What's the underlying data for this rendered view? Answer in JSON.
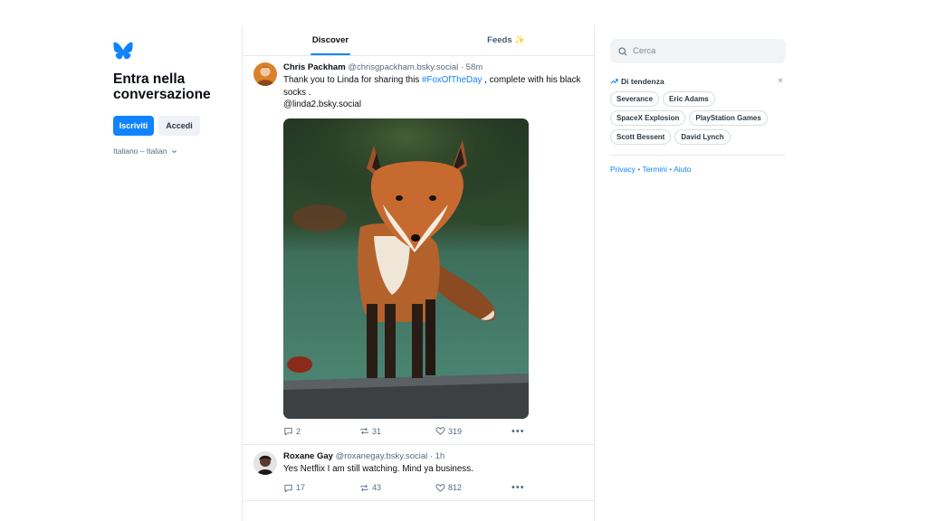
{
  "app": {
    "headline": "Entra nella conversazione",
    "signup_label": "Iscriviti",
    "login_label": "Accedi",
    "language": "Italiano – Italian",
    "logo_icon": "butterfly-icon",
    "accent": "#1083fe"
  },
  "tabs": [
    {
      "label": "Discover",
      "active": true
    },
    {
      "label": "Feeds",
      "active": false,
      "suffix": "✨"
    }
  ],
  "posts": [
    {
      "author": "Chris Packham",
      "handle": "@chrisgpackham.bsky.social",
      "time": "· 58m",
      "text_before": "Thank you to Linda for sharing this ",
      "hashtag": "#FoxOfTheDay",
      "text_after": " , complete with his black socks .",
      "mention": "@linda2.bsky.social",
      "replies": "2",
      "reposts": "31",
      "likes": "319",
      "image": "fox-photo"
    },
    {
      "author": "Roxane Gay",
      "handle": "@roxanegay.bsky.social",
      "time": "· 1h",
      "text": "Yes Netflix I am still watching. Mind ya business.",
      "replies": "17",
      "reposts": "43",
      "likes": "812"
    }
  ],
  "sidebar": {
    "search_placeholder": "Cerca",
    "trending_title": "Di tendenza",
    "close_glyph": "×",
    "trending": [
      "Severance",
      "Eric Adams",
      "SpaceX Explosion",
      "PlayStation Games",
      "Scott Bessent",
      "David Lynch"
    ],
    "footer": {
      "privacy": "Privacy",
      "terms": "Termini",
      "help": "Aiuto",
      "separator": "•"
    }
  }
}
